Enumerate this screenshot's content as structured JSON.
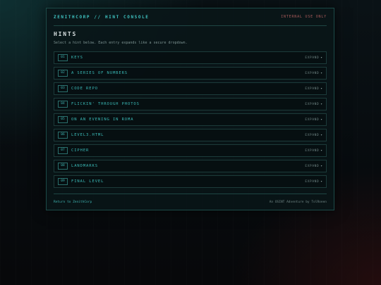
{
  "header": {
    "brand": "ZENITHCORP // HINT CONSOLE",
    "internal_badge": "INTERNAL USE ONLY"
  },
  "main": {
    "title": "HINTS",
    "intro": "Select a hint below. Each entry expands like a secure dropdown."
  },
  "hints": [
    {
      "num": "01",
      "title": "KEYS",
      "action": "EXPAND"
    },
    {
      "num": "02",
      "title": "A SERIES OF NUMBERS",
      "action": "EXPAND"
    },
    {
      "num": "03",
      "title": "CODE REPO",
      "action": "EXPAND"
    },
    {
      "num": "04",
      "title": "FLICKIN' THROUGH PHOTOS",
      "action": "EXPAND"
    },
    {
      "num": "05",
      "title": "ON AN EVENING IN ROMA",
      "action": "EXPAND"
    },
    {
      "num": "06",
      "title": "LEVEL3.HTML",
      "action": "EXPAND"
    },
    {
      "num": "07",
      "title": "CIPHER",
      "action": "EXPAND"
    },
    {
      "num": "08",
      "title": "LANDMARKS",
      "action": "EXPAND"
    },
    {
      "num": "09",
      "title": "FINAL LEVEL",
      "action": "EXPAND"
    }
  ],
  "footer": {
    "return_link": "Return to ZenithCorp",
    "credit": "An OSINT Adventure by TolRoeen"
  },
  "icons": {
    "expand": "chevron-down-icon"
  },
  "colors": {
    "accent": "#3fc2c0",
    "warning": "#a85a5a",
    "background": "#06090c"
  }
}
